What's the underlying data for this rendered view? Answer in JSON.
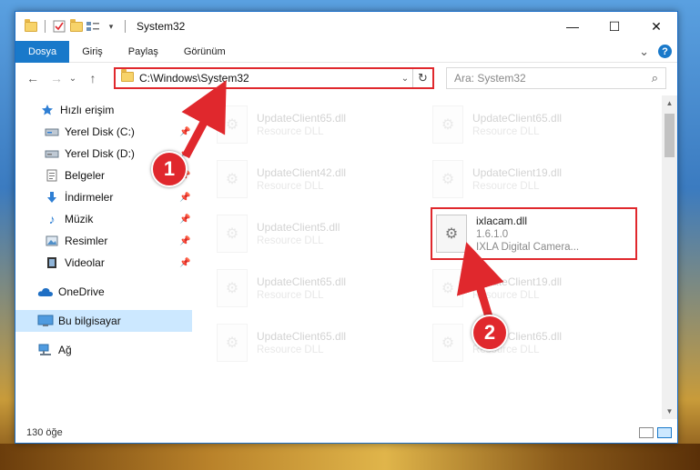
{
  "window": {
    "title": "System32",
    "controls": {
      "minimize": "—",
      "maximize": "☐",
      "close": "✕"
    }
  },
  "ribbon": {
    "tabs": [
      "Dosya",
      "Giriş",
      "Paylaş",
      "Görünüm"
    ],
    "expand": "⌄",
    "help": "?"
  },
  "nav": {
    "back": "←",
    "forward": "→",
    "recent": "⌄",
    "up": "↑",
    "address": "C:\\Windows\\System32",
    "address_dropdown": "⌄",
    "refresh": "↻",
    "search_placeholder": "Ara: System32",
    "search_icon": "⌕"
  },
  "sidebar": {
    "items": [
      {
        "label": "Hızlı erişim",
        "icon": "star-icon",
        "pinned": false
      },
      {
        "label": "Yerel Disk (C:)",
        "icon": "drive-icon",
        "pinned": true
      },
      {
        "label": "Yerel Disk (D:)",
        "icon": "drive-icon",
        "pinned": true
      },
      {
        "label": "Belgeler",
        "icon": "documents-icon",
        "pinned": true
      },
      {
        "label": "İndirmeler",
        "icon": "download-icon",
        "pinned": true
      },
      {
        "label": "Müzik",
        "icon": "music-icon",
        "pinned": true
      },
      {
        "label": "Resimler",
        "icon": "pictures-icon",
        "pinned": true
      },
      {
        "label": "Videolar",
        "icon": "videos-icon",
        "pinned": true
      },
      {
        "label": "OneDrive",
        "icon": "cloud-icon",
        "pinned": false
      },
      {
        "label": "Bu bilgisayar",
        "icon": "computer-icon",
        "pinned": false,
        "selected": true
      },
      {
        "label": "Ağ",
        "icon": "network-icon",
        "pinned": false
      }
    ],
    "pin_glyph": "📌"
  },
  "files": {
    "col1": [
      {
        "name": "UpdateClient65.dll",
        "sub": "Resource DLL"
      },
      {
        "name": "UpdateClient42.dll",
        "sub": "Resource DLL"
      },
      {
        "name": "UpdateClient5.dll",
        "sub": "Resource DLL"
      },
      {
        "name": "UpdateClient65.dll",
        "sub": "Resource DLL"
      },
      {
        "name": "UpdateClient65.dll",
        "sub": "Resource DLL"
      }
    ],
    "col2": [
      {
        "name": "UpdateClient65.dll",
        "sub": "Resource DLL"
      },
      {
        "name": "UpdateClient19.dll",
        "sub": "Resource DLL"
      },
      {
        "name": "ixlacam.dll",
        "sub": "1.6.1.0",
        "sub2": "IXLA Digital Camera...",
        "highlight": true
      },
      {
        "name": "UpdateClient19.dll",
        "sub": "Resource DLL"
      },
      {
        "name": "UpdateClient65.dll",
        "sub": "Resource DLL"
      }
    ]
  },
  "status": {
    "item_count": "130 öğe"
  },
  "annotations": {
    "badge1": "1",
    "badge2": "2"
  },
  "colors": {
    "accent": "#1979ca",
    "highlight": "#e0282d"
  }
}
